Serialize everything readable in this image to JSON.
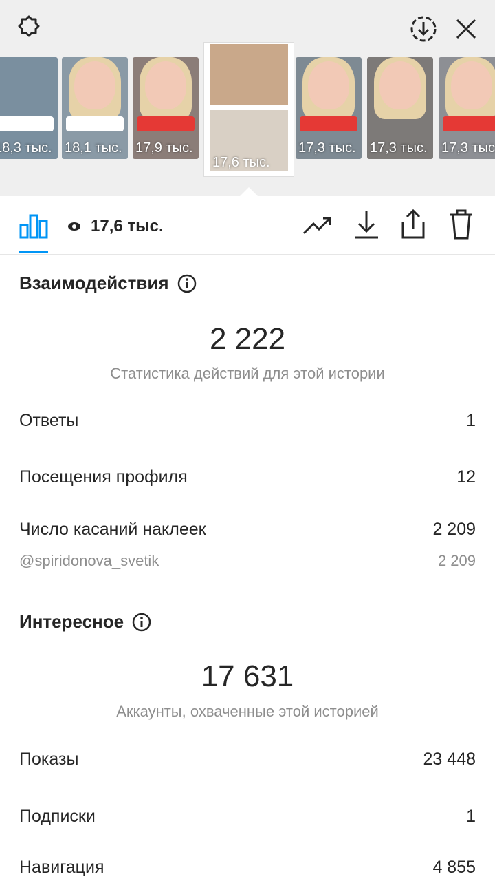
{
  "thumbs": [
    {
      "views": "18,3 тыс."
    },
    {
      "views": "18,1 тыс."
    },
    {
      "views": "17,9 тыс."
    },
    {
      "views": "17,6 тыс."
    },
    {
      "views": "17,3 тыс."
    },
    {
      "views": "17,3 тыс."
    },
    {
      "views": "17,3 тыс."
    }
  ],
  "toolbar": {
    "views": "17,6 тыс."
  },
  "interactions": {
    "title": "Взаимодействия",
    "total": "2 222",
    "subtitle": "Статистика действий для этой истории",
    "rows": [
      {
        "label": "Ответы",
        "value": "1"
      },
      {
        "label": "Посещения профиля",
        "value": "12"
      },
      {
        "label": "Число касаний наклеек",
        "value": "2 209"
      },
      {
        "label": "@spiridonova_svetik",
        "value": "2 209"
      }
    ]
  },
  "discovery": {
    "title": "Интересное",
    "total": "17 631",
    "subtitle": "Аккаунты, охваченные этой историей",
    "rows": [
      {
        "label": "Показы",
        "value": "23 448"
      },
      {
        "label": "Подписки",
        "value": "1"
      },
      {
        "label": "Навигация",
        "value": "4 855"
      }
    ]
  },
  "colors": {
    "accent": "#0095f6",
    "muted": "#8e8e8e"
  }
}
